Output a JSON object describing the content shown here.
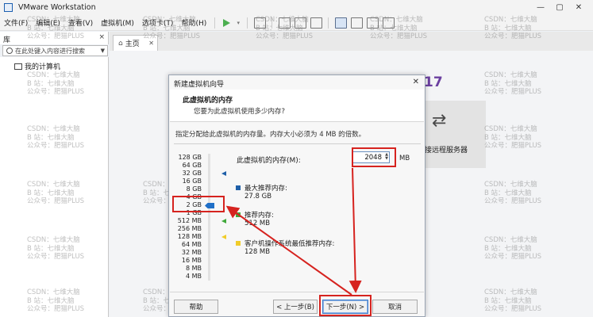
{
  "window": {
    "title": "VMware Workstation",
    "controls": [
      "—",
      "▢",
      "✕"
    ]
  },
  "menu": [
    "文件(F)",
    "编辑(E)",
    "查看(V)",
    "虚拟机(M)",
    "选项卡(T)",
    "帮助(H)"
  ],
  "library": {
    "title": "库",
    "close": "×",
    "search_placeholder": "在此处键入内容进行搜索",
    "items": [
      "我的计算机"
    ]
  },
  "tabs": [
    {
      "label": "主页"
    }
  ],
  "home": {
    "brand_fragment": "17",
    "remote_label": "接远程服务器"
  },
  "watermark": "CSDN：七维大脑\nB 站：七维大脑\n公众号：肥猫PLUS",
  "dialog": {
    "title": "新建虚拟机向导",
    "heading": "此虚拟机的内存",
    "subheading": "您要为此虚拟机使用多少内存?",
    "description": "指定分配给此虚拟机的内存量。内存大小必须为 4 MB 的倍数。",
    "memory_label": "此虚拟机的内存(M):",
    "memory_value": "2048",
    "memory_unit": "MB",
    "scale_labels": [
      "128 GB",
      "64 GB",
      "32 GB",
      "16 GB",
      "8 GB",
      "4 GB",
      "2 GB",
      "1 GB",
      "512 MB",
      "256 MB",
      "128 MB",
      "64 MB",
      "32 MB",
      "16 MB",
      "8 MB",
      "4 MB"
    ],
    "selected_scale": "2 GB",
    "recommendations": [
      {
        "title": "最大推荐内存:",
        "value": "27.8 GB",
        "color": "#1f5fa8"
      },
      {
        "title": "推荐内存:",
        "value": "512 MB",
        "color": "#3fa83a"
      },
      {
        "title": "客户机操作系统最低推荐内存:",
        "value": "128 MB",
        "color": "#f0cc2a"
      }
    ],
    "buttons": {
      "help": "帮助",
      "back": "< 上一步(B)",
      "next": "下一步(N) >",
      "cancel": "取消"
    }
  }
}
